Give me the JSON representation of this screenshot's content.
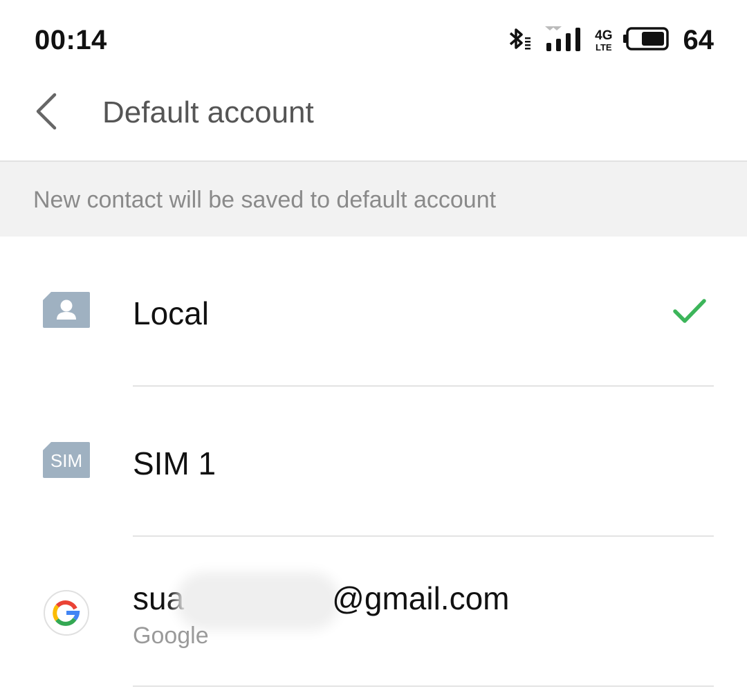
{
  "status_bar": {
    "time": "00:14",
    "network_top": "4G",
    "network_bottom": "LTE",
    "battery_level": "64",
    "icons": [
      "bluetooth-icon",
      "signal-icon",
      "lte-icon",
      "battery-icon"
    ]
  },
  "toolbar": {
    "back_icon": "chevron-left-icon",
    "title": "Default account"
  },
  "hint": {
    "text": "New contact will be saved to default account"
  },
  "accounts": [
    {
      "label": "Local",
      "icon": "local-contact-icon",
      "selected": true
    },
    {
      "label": "SIM 1",
      "icon": "sim-card-icon",
      "icon_text": "SIM",
      "selected": false
    },
    {
      "label_prefix": "sua",
      "label_suffix": "@gmail.com",
      "sublabel": "Google",
      "icon": "google-icon",
      "selected": false
    }
  ],
  "colors": {
    "check": "#3cb55a",
    "icon_gray": "#9fb1c1",
    "title": "#555555",
    "hint_bg": "#f2f2f2"
  }
}
